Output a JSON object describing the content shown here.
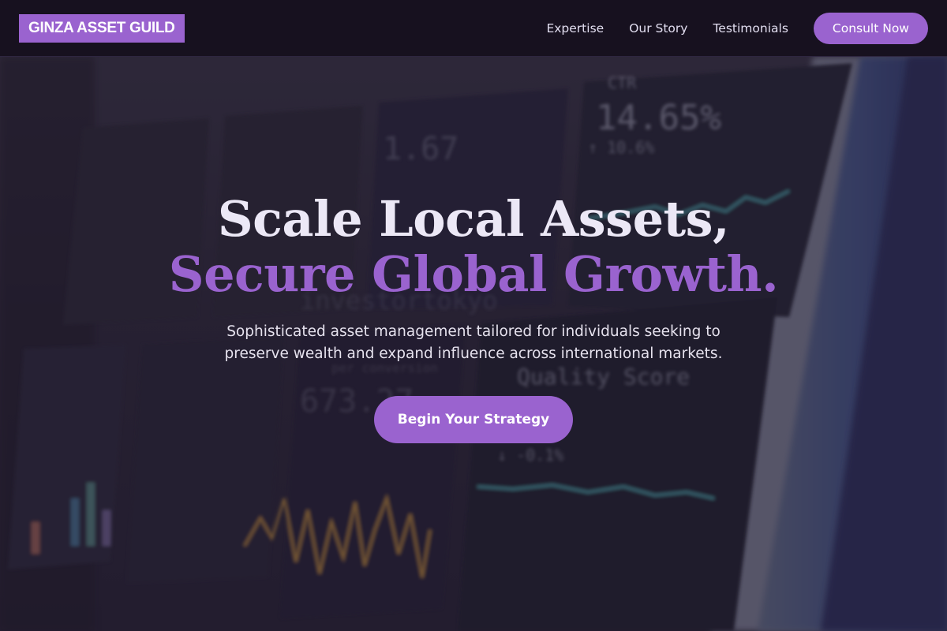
{
  "brand": {
    "name": "GINZA ASSET GUILD"
  },
  "nav": {
    "links": [
      "Expertise",
      "Our Story",
      "Testimonials"
    ],
    "cta_label": "Consult Now"
  },
  "hero": {
    "headline_line1": "Scale Local Assets,",
    "headline_line2": "Secure Global Growth.",
    "subtext_line1": "Sophisticated asset management tailored for individuals seeking to",
    "subtext_line2": "preserve wealth and expand influence across international markets.",
    "cta_label": "Begin Your Strategy",
    "background_image": {
      "description": "blurred analytics dashboard monitor",
      "visible_texts": [
        "CTR",
        "14.65%",
        "↑ 10.6%",
        "1.67",
        "Quality Score",
        "673.27",
        "↓ -0.1%",
        "per conversion",
        "investortokyo"
      ]
    }
  },
  "colors": {
    "accent": "#9a63cf",
    "nav_bg": "#17111f",
    "headline": "#ece8f6"
  }
}
